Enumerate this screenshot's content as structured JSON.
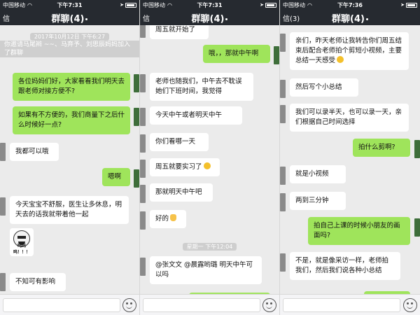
{
  "panels": [
    {
      "status": {
        "carrier": "中国移动",
        "time": "下午7:31"
      },
      "nav": {
        "back": "信",
        "title": "群聊(4)"
      },
      "timestamp": "2017年10月12日 下午6:27",
      "system_message": "你邀请马尾辫 ~~、马弃予、刘思辰妈妈加入了群聊",
      "messages": [
        {
          "side": "out",
          "text": "各位妈妈们好，大家看看我们明天去跟老师对接方便不?"
        },
        {
          "side": "out",
          "text": "如果有不方便的，我们商量下之后什么时候好一点?"
        },
        {
          "side": "in",
          "text": "我都可以哦"
        },
        {
          "side": "out",
          "text": "嗯啊"
        },
        {
          "side": "in",
          "text": "今天宝宝不舒服，医生让多休息，明天去的话我就带着他一起"
        },
        {
          "side": "in",
          "text": "不知可有影响"
        }
      ],
      "sticker_caption": "呜呜呜！！！"
    },
    {
      "status": {
        "carrier": "中国移动",
        "time": "下午7:31"
      },
      "nav": {
        "back": "信",
        "title": "群聊(4)"
      },
      "messages": [
        {
          "side": "in",
          "text": "周五就开始了"
        },
        {
          "side": "out",
          "text": "哦，，那就中午啊"
        },
        {
          "side": "in",
          "text": "老师也随我们，中午去不耽误她们下班时间，我觉得"
        },
        {
          "side": "in",
          "text": "今天中午或者明天中午"
        },
        {
          "side": "in",
          "text": "你们看哪一天"
        },
        {
          "side": "in",
          "text": "周五就要实习了"
        },
        {
          "side": "in",
          "text": "那就明天中午吧"
        },
        {
          "side": "in",
          "text": "好的"
        },
        {
          "side": "in",
          "text": "@张文文 @晨露哟璐 明天中午可以吗"
        }
      ],
      "timestamp": "星期一 下午12:04"
    },
    {
      "status": {
        "carrier": "中国移动",
        "time": "下午7:36"
      },
      "nav": {
        "back": "信(3)",
        "title": "群聊(4)"
      },
      "messages": [
        {
          "side": "in",
          "text": "亲们，昨天老师让我转告你们周五结束后配合老师拍个剪短小视频，主要总结一天感受"
        },
        {
          "side": "in",
          "text": "然后写个小总结"
        },
        {
          "side": "in",
          "text": "我们可以录半天，也可以录一天，亲们根据自己时间选择"
        },
        {
          "side": "out",
          "text": "拍什么剪啊?"
        },
        {
          "side": "in",
          "text": "就是小视频"
        },
        {
          "side": "in",
          "text": "两到三分钟"
        },
        {
          "side": "out",
          "text": "拍自己上课的时候小朋友的画面吗?"
        },
        {
          "side": "in",
          "text": "不是，就是像采访一样，老师拍我们，然后我们说各种小总结"
        }
      ]
    }
  ],
  "colors": {
    "navbar": "#262a30",
    "chat_bg": "#ebebeb",
    "bubble_out": "#9fe45b",
    "bubble_in": "#ffffff"
  },
  "icons": {
    "emoji_button": "smiley-icon",
    "battery": "battery-icon",
    "wifi": "wifi-icon"
  }
}
